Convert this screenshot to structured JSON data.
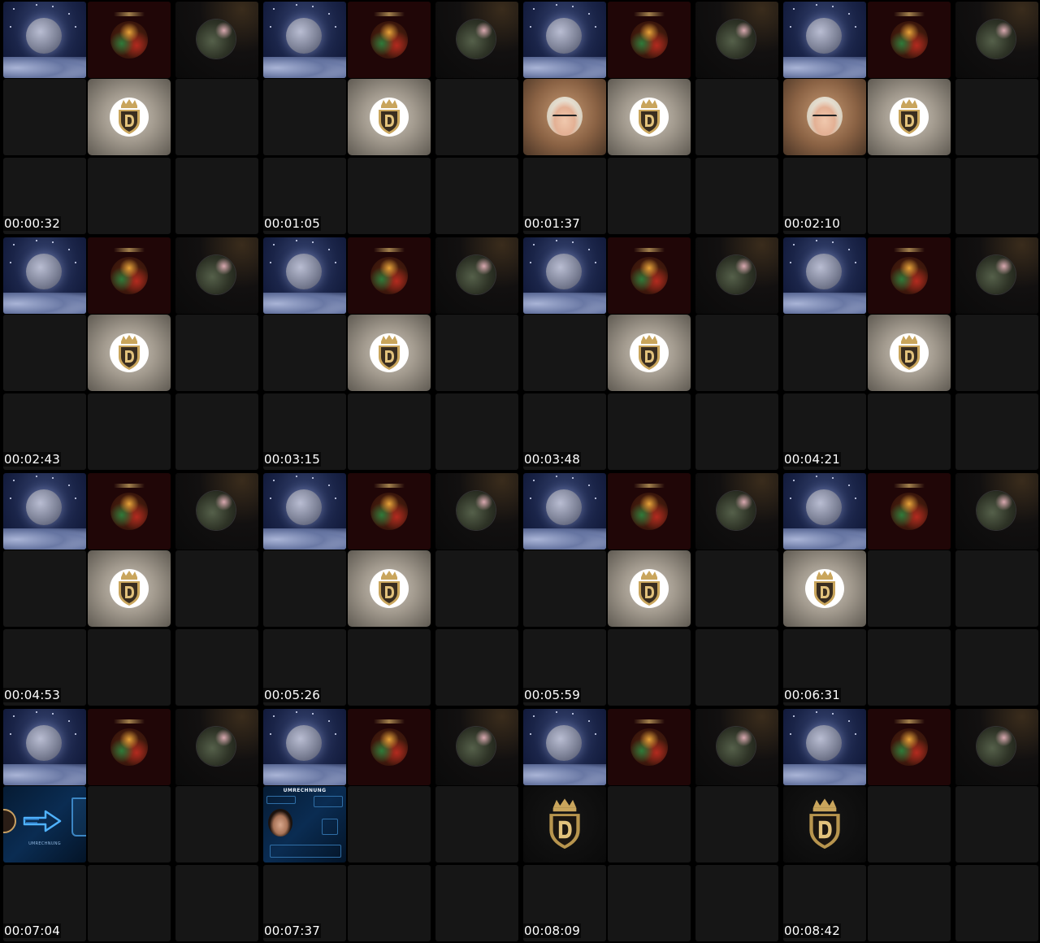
{
  "contact_sheet": {
    "frames": [
      {
        "timestamp": "00:00:32",
        "variant": "logo"
      },
      {
        "timestamp": "00:01:05",
        "variant": "logo"
      },
      {
        "timestamp": "00:01:37",
        "variant": "person_logo"
      },
      {
        "timestamp": "00:02:10",
        "variant": "person_logo"
      },
      {
        "timestamp": "00:02:43",
        "variant": "logo"
      },
      {
        "timestamp": "00:03:15",
        "variant": "logo"
      },
      {
        "timestamp": "00:03:48",
        "variant": "logo_col2"
      },
      {
        "timestamp": "00:04:21",
        "variant": "logo_col2"
      },
      {
        "timestamp": "00:04:53",
        "variant": "logo"
      },
      {
        "timestamp": "00:05:26",
        "variant": "logo"
      },
      {
        "timestamp": "00:05:59",
        "variant": "logo_col2"
      },
      {
        "timestamp": "00:06:31",
        "variant": "logo_col1"
      },
      {
        "timestamp": "00:07:04",
        "variant": "info_arrow"
      },
      {
        "timestamp": "00:07:37",
        "variant": "info_portrait"
      },
      {
        "timestamp": "00:08:09",
        "variant": "dlogo"
      },
      {
        "timestamp": "00:08:42",
        "variant": "dlogo"
      }
    ],
    "infographic": {
      "title": "UMRECHNUNG",
      "caption": "UMRECHNUNG"
    },
    "colors": {
      "background": "#000000",
      "empty_tile": "#161616",
      "moon_sky": "#1a2448",
      "warrior_bg": "#200607",
      "logo_gold": "#c9a55c",
      "logo_dark": "#3a2e20",
      "infographic_blue": "#0a2c52"
    },
    "icons": {
      "moon": "moon-clouds-icon",
      "warrior": "warrior-avatar-icon",
      "profile": "profile-avatar-icon",
      "logo": "d-shield-crown-icon"
    }
  }
}
